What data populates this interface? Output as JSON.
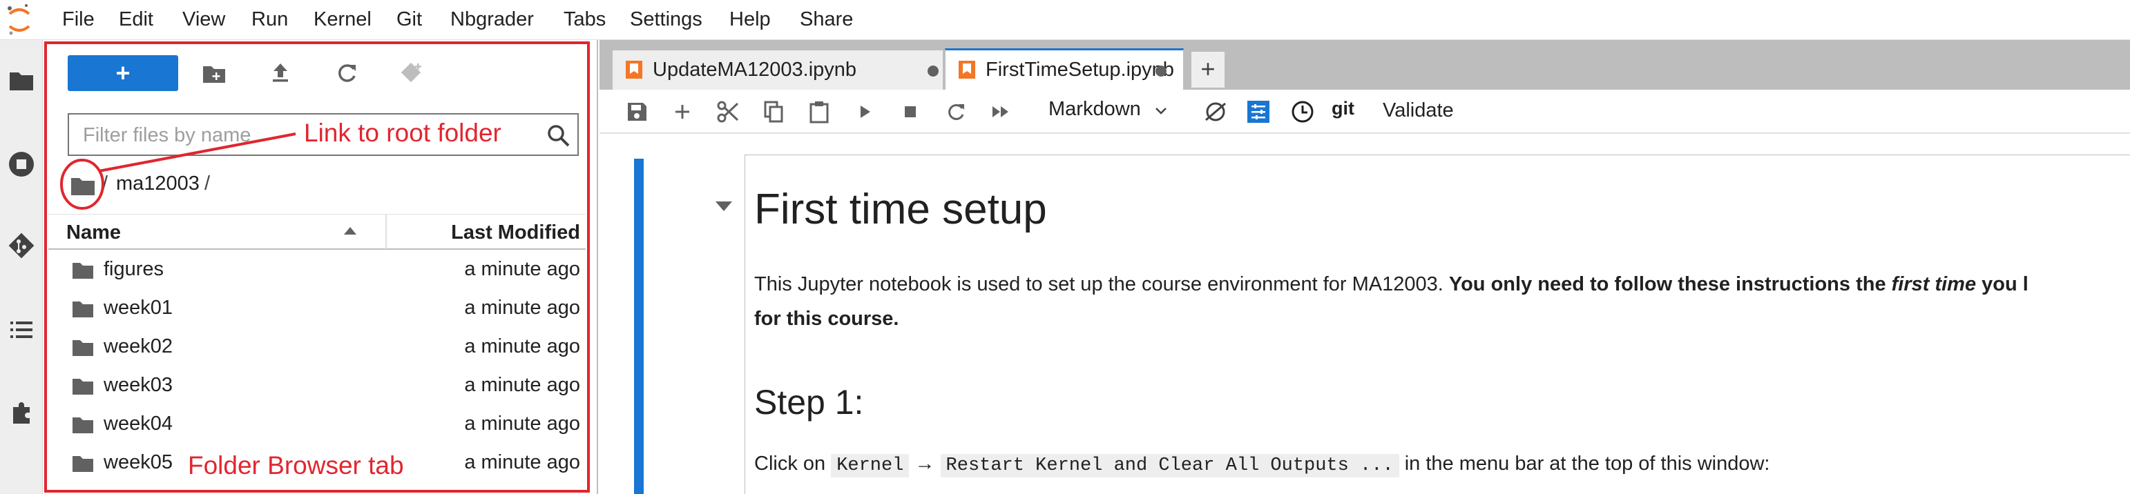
{
  "menubar": {
    "items": [
      "File",
      "Edit",
      "View",
      "Run",
      "Kernel",
      "Git",
      "Nbgrader",
      "Tabs",
      "Settings",
      "Help",
      "Share"
    ]
  },
  "activitybar": {
    "icons": [
      "folder-icon",
      "running-icon",
      "git-icon",
      "toc-icon",
      "extension-icon"
    ]
  },
  "filebrowser": {
    "new_label": "+",
    "filter_placeholder": "Filter files by name",
    "breadcrumb": {
      "sep": "/",
      "dir": "ma12003",
      "trailing": "/"
    },
    "columns": {
      "name": "Name",
      "modified": "Last Modified"
    },
    "files": [
      {
        "name": "figures",
        "modified": "a minute ago"
      },
      {
        "name": "week01",
        "modified": "a minute ago"
      },
      {
        "name": "week02",
        "modified": "a minute ago"
      },
      {
        "name": "week03",
        "modified": "a minute ago"
      },
      {
        "name": "week04",
        "modified": "a minute ago"
      },
      {
        "name": "week05",
        "modified": "a minute ago"
      }
    ]
  },
  "annotations": {
    "root_link": "Link to root folder",
    "browser_tab": "Folder Browser tab",
    "color": "#e0262f"
  },
  "tabs": [
    {
      "label": "UpdateMA12003.ipynb",
      "active": false
    },
    {
      "label": "FirstTimeSetup.ipynb",
      "active": true
    }
  ],
  "new_tab_label": "+",
  "notebook_toolbar": {
    "cell_type": "Markdown",
    "git_label": "git",
    "validate_label": "Validate"
  },
  "notebook": {
    "heading": "First time setup",
    "intro_plain": "This Jupyter notebook is used to set up the course environment for MA12003. ",
    "intro_bold_1": "You only need to follow these instructions the ",
    "intro_bold_italic": "first time",
    "intro_bold_2": " you l",
    "intro_line2": "for this course.",
    "step_heading": "Step 1:",
    "step_text_1": "Click on ",
    "code_kernel": "Kernel",
    "arrow": "→",
    "code_restart": "Restart Kernel and Clear All Outputs ...",
    "step_text_2": " in the menu bar at the top of this window:"
  },
  "colors": {
    "accent": "#1976d2",
    "annotation": "#e0262f",
    "activitybar": "#eeeeee"
  }
}
